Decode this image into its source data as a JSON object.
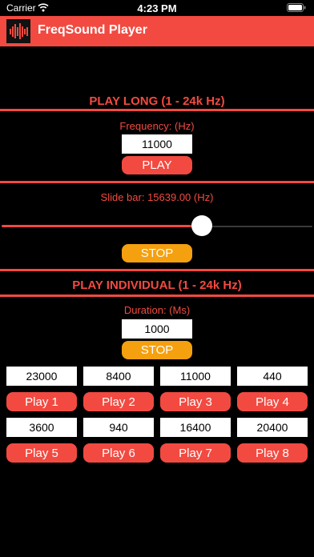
{
  "status": {
    "carrier": "Carrier",
    "time": "4:23 PM"
  },
  "app": {
    "title": "FreqSound Player"
  },
  "play_long": {
    "heading": "PLAY LONG (1 - 24k Hz)",
    "frequency_label": "Frequency: (Hz)",
    "frequency_value": "11000",
    "play_label": "PLAY"
  },
  "slider": {
    "label": "Slide bar: 15639.00 (Hz)",
    "value": 15639.0,
    "min": 1,
    "max": 24000,
    "stop_label": "STOP"
  },
  "play_individual": {
    "heading": "PLAY INDIVIDUAL (1 - 24k Hz)",
    "duration_label": "Duration: (Ms)",
    "duration_value": "1000",
    "stop_label": "STOP",
    "tones": [
      {
        "freq": "23000",
        "label": "Play 1"
      },
      {
        "freq": "8400",
        "label": "Play 2"
      },
      {
        "freq": "11000",
        "label": "Play 3"
      },
      {
        "freq": "440",
        "label": "Play 4"
      },
      {
        "freq": "3600",
        "label": "Play 5"
      },
      {
        "freq": "940",
        "label": "Play 6"
      },
      {
        "freq": "16400",
        "label": "Play 7"
      },
      {
        "freq": "20400",
        "label": "Play 8"
      }
    ]
  },
  "colors": {
    "accent": "#f24a41",
    "stop": "#f5a00f",
    "background": "#000000"
  }
}
